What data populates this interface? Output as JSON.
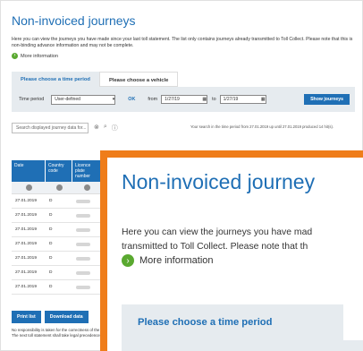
{
  "page": {
    "title": "Non-invoiced journeys",
    "intro": "Here you can view the journeys you have made since your last toll statement. The list only contains journeys already transmitted to Toll Collect. Please note that this is non-binding advance information and may not be complete.",
    "more_info": "More information"
  },
  "tabs": [
    {
      "label": "Please choose a time period"
    },
    {
      "label": "Please choose a vehicle"
    }
  ],
  "filter": {
    "time_period_label": "Time period",
    "time_period_value": "User-defined",
    "ok_label": "OK",
    "from_label": "from",
    "from_value": "1/27/19",
    "to_label": "to",
    "to_value": "1/27/19",
    "show_button": "Show journeys"
  },
  "search": {
    "placeholder": "Search displayed journey data for...",
    "summary": "Your search in the time period from 27.01.2019 up until 27.01.2019 produced 14 hit(s)."
  },
  "table": {
    "headers": [
      "Date",
      "Country code",
      "Licence plate number"
    ],
    "rows": [
      {
        "date": "27.01.2019",
        "country": "D"
      },
      {
        "date": "27.01.2019",
        "country": "D"
      },
      {
        "date": "27.01.2019",
        "country": "D"
      },
      {
        "date": "27.01.2019",
        "country": "D"
      },
      {
        "date": "27.01.2019",
        "country": "D"
      },
      {
        "date": "27.01.2019",
        "country": "D"
      },
      {
        "date": "27.01.2019",
        "country": "D"
      }
    ]
  },
  "actions": {
    "print": "Print list",
    "download": "Download data"
  },
  "footer_note": "No responsibility is taken for the correctness of the data. The next toll statement shall take legal precedence.",
  "zoom": {
    "title": "Non-invoiced journey",
    "intro_line1": "Here you can view the journeys you have mad",
    "intro_line2": "transmitted to Toll Collect. Please note that th",
    "more_info": "More information",
    "tab_label": "Please choose a time period"
  },
  "colors": {
    "accent": "#1f6fb5",
    "highlight_border": "#ef7d1a",
    "info_icon": "#5aa930"
  }
}
